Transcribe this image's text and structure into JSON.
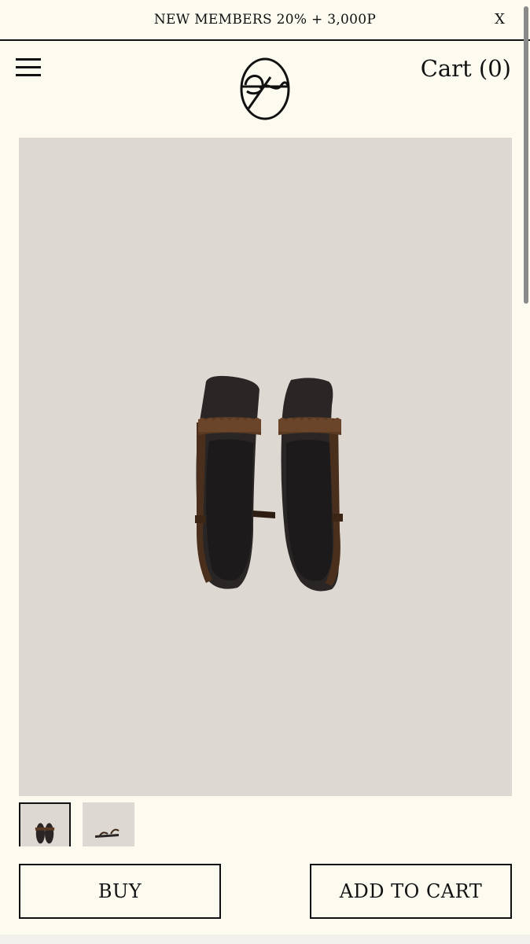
{
  "promo": {
    "text": "NEW MEMBERS 20% + 3,000P",
    "close_label": "X"
  },
  "header": {
    "menu_icon": "hamburger-menu-icon",
    "logo_icon": "brand-logo",
    "cart_label": "Cart (0)"
  },
  "product": {
    "image_icon": "sandals-product-photo",
    "thumbnails": [
      {
        "icon": "sandals-top-view-thumbnail",
        "selected": true
      },
      {
        "icon": "sandal-side-view-thumbnail",
        "selected": false
      }
    ]
  },
  "actions": {
    "buy_label": "BUY",
    "add_to_cart_label": "ADD TO CART"
  },
  "colors": {
    "background": "#fdfaf0",
    "image_background": "#ddd8d1",
    "text": "#111111",
    "leather": "#5a3a22"
  }
}
